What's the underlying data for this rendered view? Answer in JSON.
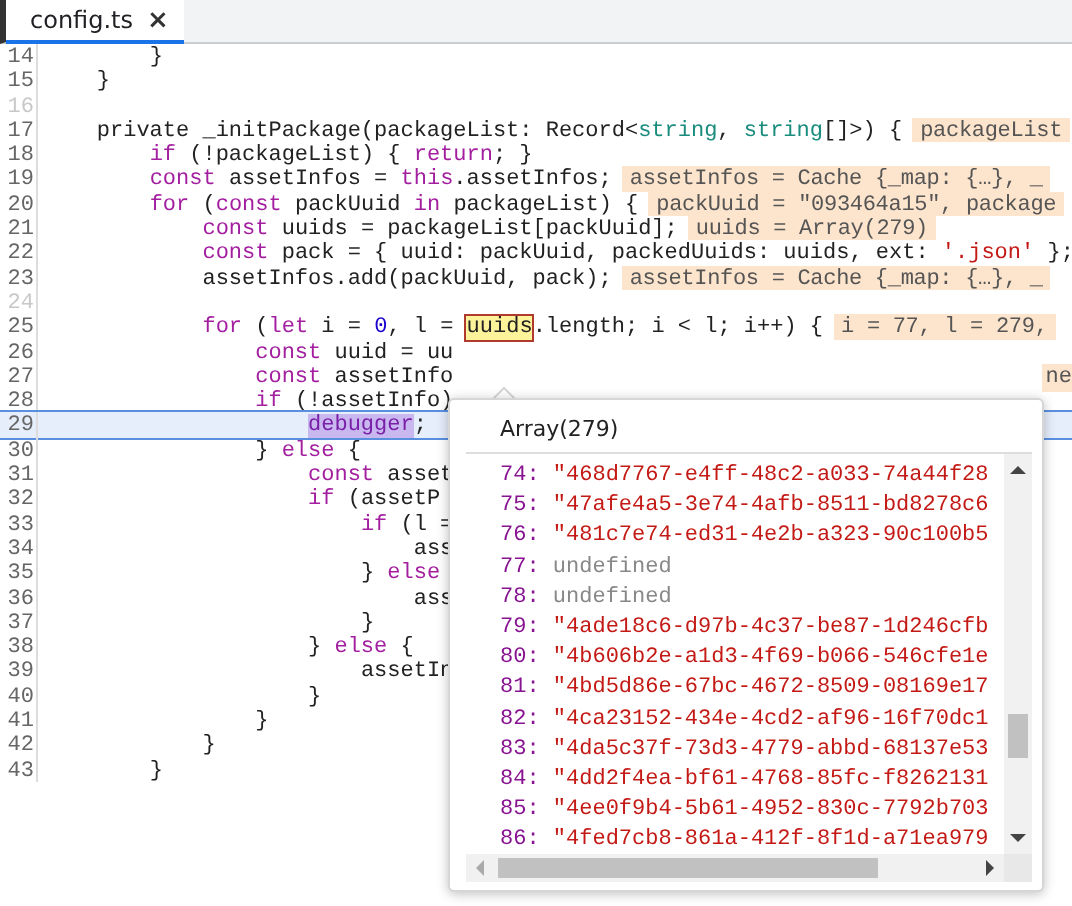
{
  "tabs": [
    {
      "label": "config.ts",
      "selected": true,
      "close": "×"
    }
  ],
  "lines": [
    {
      "number": "14",
      "dim": false,
      "current": false,
      "tokens": [
        {
          "t": "        }",
          "kind": "plain"
        }
      ]
    },
    {
      "number": "15",
      "dim": false,
      "current": false,
      "tokens": [
        {
          "t": "    }",
          "kind": "plain"
        }
      ]
    },
    {
      "number": "16",
      "dim": true,
      "current": false
    },
    {
      "number": "17",
      "dim": false,
      "current": false,
      "tokens": [
        {
          "t": "    private _initPackage(packageList: Record<",
          "kind": "plain"
        },
        {
          "t": "string",
          "kind": "type"
        },
        {
          "t": ", ",
          "kind": "plain"
        },
        {
          "t": "string",
          "kind": "type"
        },
        {
          "t": "[]>) {",
          "kind": "plain"
        }
      ],
      "inline_value": "packageList"
    },
    {
      "number": "18",
      "dim": false,
      "current": false,
      "tokens": [
        {
          "t": "        if",
          "kind": "kw"
        },
        {
          "t": " (!packageList) { ",
          "kind": "plain"
        },
        {
          "t": "return",
          "kind": "kw"
        },
        {
          "t": "; }",
          "kind": "plain"
        }
      ]
    },
    {
      "number": "19",
      "dim": false,
      "current": false,
      "tokens": [
        {
          "t": "        const",
          "kind": "kw"
        },
        {
          "t": " assetInfos = ",
          "kind": "plain"
        },
        {
          "t": "this",
          "kind": "kw"
        },
        {
          "t": ".assetInfos;",
          "kind": "plain"
        }
      ],
      "inline_value": "assetInfos = Cache {_map: {…}, _"
    },
    {
      "number": "20",
      "dim": false,
      "current": false,
      "tokens": [
        {
          "t": "        for",
          "kind": "kw"
        },
        {
          "t": " (",
          "kind": "plain"
        },
        {
          "t": "const",
          "kind": "kw"
        },
        {
          "t": " packUuid ",
          "kind": "plain"
        },
        {
          "t": "in",
          "kind": "kw"
        },
        {
          "t": " packageList) {",
          "kind": "plain"
        }
      ],
      "inline_value": "packUuid = \"093464a15\", package"
    },
    {
      "number": "21",
      "dim": false,
      "current": false,
      "tokens": [
        {
          "t": "            const",
          "kind": "kw"
        },
        {
          "t": " uuids = packageList[packUuid];",
          "kind": "plain"
        }
      ],
      "inline_value": "uuids = Array(279)"
    },
    {
      "number": "22",
      "dim": false,
      "current": false,
      "tokens": [
        {
          "t": "            const",
          "kind": "kw"
        },
        {
          "t": " pack = { uuid: packUuid, packedUuids: uuids, ext: ",
          "kind": "plain"
        },
        {
          "t": "'.json'",
          "kind": "str"
        },
        {
          "t": " };",
          "kind": "plain"
        }
      ]
    },
    {
      "number": "23",
      "dim": false,
      "current": false,
      "tokens": [
        {
          "t": "            assetInfos.add(packUuid, pack);",
          "kind": "plain"
        }
      ],
      "inline_value": "assetInfos = Cache {_map: {…}, _"
    },
    {
      "number": "24",
      "dim": true,
      "current": false
    },
    {
      "number": "25",
      "dim": false,
      "current": false,
      "tokens": [
        {
          "t": "            for",
          "kind": "kw"
        },
        {
          "t": " (",
          "kind": "plain"
        },
        {
          "t": "let",
          "kind": "kw"
        },
        {
          "t": " i = ",
          "kind": "plain"
        },
        {
          "t": "0",
          "kind": "num"
        },
        {
          "t": ", l = ",
          "kind": "plain"
        },
        {
          "t": "uuids",
          "kind": "hover"
        },
        {
          "t": ".length; i < l; i++) {",
          "kind": "plain"
        }
      ],
      "inline_value": "i = 77, l = 279,"
    },
    {
      "number": "26",
      "dim": false,
      "current": false,
      "tokens": [
        {
          "t": "                const",
          "kind": "kw"
        },
        {
          "t": " uuid = uu",
          "kind": "plain"
        }
      ]
    },
    {
      "number": "27",
      "dim": false,
      "current": false,
      "tokens": [
        {
          "t": "                const",
          "kind": "kw"
        },
        {
          "t": " assetInfo",
          "kind": "plain"
        }
      ],
      "edge_value": "ne"
    },
    {
      "number": "28",
      "dim": false,
      "current": false,
      "tokens": [
        {
          "t": "                if",
          "kind": "kw"
        },
        {
          "t": " (!assetInfo)",
          "kind": "plain"
        }
      ]
    },
    {
      "number": "29",
      "dim": false,
      "current": true,
      "tokens": [
        {
          "t": "                    debugger",
          "kind": "sel"
        },
        {
          "t": ";",
          "kind": "plain"
        }
      ]
    },
    {
      "number": "30",
      "dim": false,
      "current": false,
      "tokens": [
        {
          "t": "                } ",
          "kind": "plain"
        },
        {
          "t": "else",
          "kind": "kw"
        },
        {
          "t": " {",
          "kind": "plain"
        }
      ]
    },
    {
      "number": "31",
      "dim": false,
      "current": false,
      "tokens": [
        {
          "t": "                    const",
          "kind": "kw"
        },
        {
          "t": " asset",
          "kind": "plain"
        }
      ]
    },
    {
      "number": "32",
      "dim": false,
      "current": false,
      "tokens": [
        {
          "t": "                    if",
          "kind": "kw"
        },
        {
          "t": " (assetP",
          "kind": "plain"
        }
      ]
    },
    {
      "number": "33",
      "dim": false,
      "current": false,
      "tokens": [
        {
          "t": "                        if",
          "kind": "kw"
        },
        {
          "t": " (l =",
          "kind": "plain"
        }
      ]
    },
    {
      "number": "34",
      "dim": false,
      "current": false,
      "tokens": [
        {
          "t": "                            ass",
          "kind": "plain"
        }
      ]
    },
    {
      "number": "35",
      "dim": false,
      "current": false,
      "tokens": [
        {
          "t": "                        } ",
          "kind": "plain"
        },
        {
          "t": "else",
          "kind": "kw"
        }
      ]
    },
    {
      "number": "36",
      "dim": false,
      "current": false,
      "tokens": [
        {
          "t": "                            ass",
          "kind": "plain"
        }
      ]
    },
    {
      "number": "37",
      "dim": false,
      "current": false,
      "tokens": [
        {
          "t": "                        }",
          "kind": "plain"
        }
      ]
    },
    {
      "number": "38",
      "dim": false,
      "current": false,
      "tokens": [
        {
          "t": "                    } ",
          "kind": "plain"
        },
        {
          "t": "else",
          "kind": "kw"
        },
        {
          "t": " {",
          "kind": "plain"
        }
      ]
    },
    {
      "number": "39",
      "dim": false,
      "current": false,
      "tokens": [
        {
          "t": "                        assetIn",
          "kind": "plain"
        }
      ]
    },
    {
      "number": "40",
      "dim": false,
      "current": false,
      "tokens": [
        {
          "t": "                    }",
          "kind": "plain"
        }
      ]
    },
    {
      "number": "41",
      "dim": false,
      "current": false,
      "tokens": [
        {
          "t": "                }",
          "kind": "plain"
        }
      ]
    },
    {
      "number": "42",
      "dim": false,
      "current": false,
      "tokens": [
        {
          "t": "            }",
          "kind": "plain"
        }
      ]
    },
    {
      "number": "43",
      "dim": false,
      "current": false,
      "tokens": [
        {
          "t": "        }",
          "kind": "plain"
        }
      ]
    }
  ],
  "popover": {
    "title": "Array(279)",
    "entries": [
      {
        "index": "74:",
        "value": "\"468d7767-e4ff-48c2-a033-74a44f28",
        "kind": "string"
      },
      {
        "index": "75:",
        "value": "\"47afe4a5-3e74-4afb-8511-bd8278c6",
        "kind": "string"
      },
      {
        "index": "76:",
        "value": "\"481c7e74-ed31-4e2b-a323-90c100b5",
        "kind": "string"
      },
      {
        "index": "77:",
        "value": "undefined",
        "kind": "undefined"
      },
      {
        "index": "78:",
        "value": "undefined",
        "kind": "undefined"
      },
      {
        "index": "79:",
        "value": "\"4ade18c6-d97b-4c37-be87-1d246cfb",
        "kind": "string"
      },
      {
        "index": "80:",
        "value": "\"4b606b2e-a1d3-4f69-b066-546cfe1e",
        "kind": "string"
      },
      {
        "index": "81:",
        "value": "\"4bd5d86e-67bc-4672-8509-08169e17",
        "kind": "string"
      },
      {
        "index": "82:",
        "value": "\"4ca23152-434e-4cd2-af96-16f70dc1",
        "kind": "string"
      },
      {
        "index": "83:",
        "value": "\"4da5c37f-73d3-4779-abbd-68137e53",
        "kind": "string"
      },
      {
        "index": "84:",
        "value": "\"4dd2f4ea-bf61-4768-85fc-f8262131",
        "kind": "string"
      },
      {
        "index": "85:",
        "value": "\"4ee0f9b4-5b61-4952-830c-7792b703",
        "kind": "string"
      },
      {
        "index": "86:",
        "value": "\"4fed7cb8-861a-412f-8f1d-a71ea979",
        "kind": "string"
      }
    ]
  }
}
